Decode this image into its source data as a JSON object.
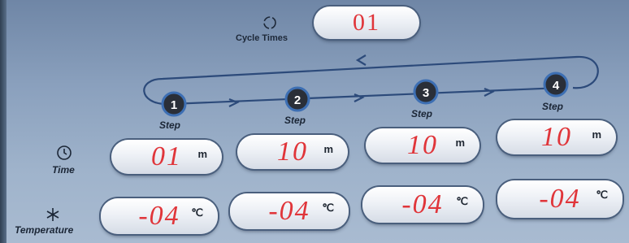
{
  "cycle": {
    "label": "Cycle Times",
    "value": "01",
    "icon": "refresh-icon"
  },
  "steps": [
    {
      "number": "1",
      "label": "Step",
      "time": "01",
      "time_unit": "m",
      "temp": "-04",
      "temp_unit": "℃"
    },
    {
      "number": "2",
      "label": "Step",
      "time": "10",
      "time_unit": "m",
      "temp": "-04",
      "temp_unit": "℃"
    },
    {
      "number": "3",
      "label": "Step",
      "time": "10",
      "time_unit": "m",
      "temp": "-04",
      "temp_unit": "℃"
    },
    {
      "number": "4",
      "label": "Step",
      "time": "10",
      "time_unit": "m",
      "temp": "-04",
      "temp_unit": "℃"
    }
  ],
  "rows": {
    "time_label": "Time",
    "time_icon": "clock-icon",
    "temp_label": "Temperature",
    "temp_icon": "snowflake-icon"
  },
  "colors": {
    "value_red": "#e0353a",
    "flow_line": "#2c4a7a",
    "step_circle": "#2a2f38"
  }
}
